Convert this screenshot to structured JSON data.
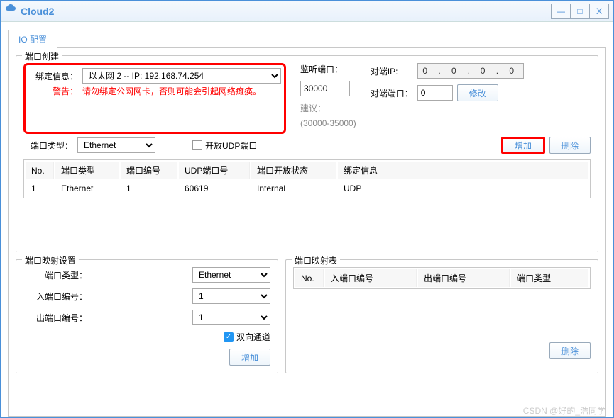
{
  "window": {
    "title": "Cloud2",
    "min": "—",
    "max": "□",
    "close": "X"
  },
  "tab": {
    "label": "IO 配置"
  },
  "portCreate": {
    "legend": "端口创建",
    "bindLabel": "绑定信息：",
    "bindValue": "以太网 2 -- IP: 192.168.74.254",
    "warnLabel": "警告：",
    "warnText": "请勿绑定公网网卡，否则可能会引起网络瘫痪。",
    "portTypeLabel": "端口类型：",
    "portTypeValue": "Ethernet",
    "openUdpLabel": "开放UDP端口",
    "listenPortLabel": "监听端口：",
    "listenPortValue": "30000",
    "suggestLabel": "建议：",
    "suggestRange": "(30000-35000)",
    "peerIpLabel": "对端IP:",
    "peerIpValue": "0  .  0  .  0  .  0",
    "peerPortLabel": "对端端口：",
    "peerPortValue": "0",
    "modifyBtn": "修改",
    "addBtn": "增加",
    "deleteBtn": "删除"
  },
  "portTable": {
    "headers": {
      "no": "No.",
      "type": "端口类型",
      "num": "端口编号",
      "udp": "UDP端口号",
      "status": "端口开放状态",
      "bind": "绑定信息"
    },
    "row": {
      "no": "1",
      "type": "Ethernet",
      "num": "1",
      "udp": "60619",
      "status": "Internal",
      "bind": "UDP"
    }
  },
  "mapSet": {
    "legend": "端口映射设置",
    "portTypeLabel": "端口类型：",
    "portTypeValue": "Ethernet",
    "inLabel": "入端口编号：",
    "inValue": "1",
    "outLabel": "出端口编号：",
    "outValue": "1",
    "bidirLabel": "双向通道",
    "addBtn": "增加"
  },
  "mapTable": {
    "legend": "端口映射表",
    "headers": {
      "no": "No.",
      "in": "入端口编号",
      "out": "出端口编号",
      "type": "端口类型"
    },
    "deleteBtn": "删除"
  },
  "watermark": "CSDN @好的_浩同学"
}
